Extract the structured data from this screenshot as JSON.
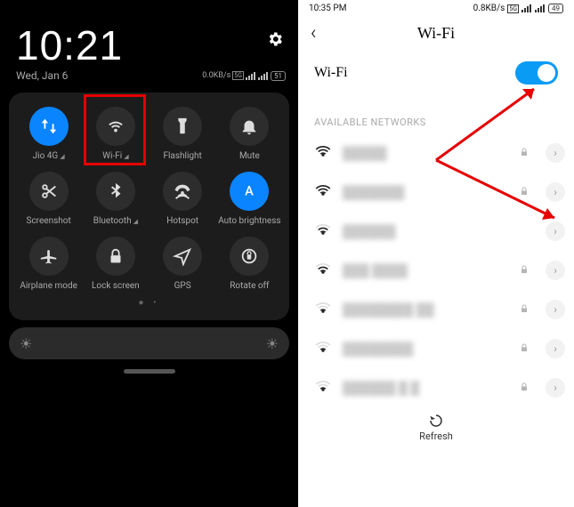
{
  "left": {
    "clock": "10:21",
    "date": "Wed, Jan 6",
    "data_rate": "0.0KB/s",
    "battery": "51",
    "tiles": [
      {
        "label": "Jio 4G",
        "has_sub": true,
        "active": true,
        "icon": "data-swap"
      },
      {
        "label": "Wi-Fi",
        "has_sub": true,
        "active": false,
        "icon": "wifi"
      },
      {
        "label": "Flashlight",
        "has_sub": false,
        "active": false,
        "icon": "flashlight"
      },
      {
        "label": "Mute",
        "has_sub": false,
        "active": false,
        "icon": "bell"
      },
      {
        "label": "Screenshot",
        "has_sub": false,
        "active": false,
        "icon": "scissors"
      },
      {
        "label": "Bluetooth",
        "has_sub": true,
        "active": false,
        "icon": "bluetooth"
      },
      {
        "label": "Hotspot",
        "has_sub": false,
        "active": false,
        "icon": "hotspot"
      },
      {
        "label": "Auto brightness",
        "has_sub": false,
        "active": true,
        "icon": "auto-a"
      },
      {
        "label": "Airplane mode",
        "has_sub": false,
        "active": false,
        "icon": "airplane"
      },
      {
        "label": "Lock screen",
        "has_sub": false,
        "active": false,
        "icon": "lock"
      },
      {
        "label": "GPS",
        "has_sub": false,
        "active": false,
        "icon": "nav"
      },
      {
        "label": "Rotate off",
        "has_sub": false,
        "active": false,
        "icon": "rotate-lock"
      }
    ]
  },
  "right": {
    "status_time": "10:35 PM",
    "data_rate": "0.8KB/s",
    "battery": "49",
    "page_title": "Wi-Fi",
    "toggle_label": "Wi-Fi",
    "toggle_on": true,
    "section_header": "AVAILABLE NETWORKS",
    "networks": [
      {
        "strength": 4,
        "locked": true,
        "detail": true,
        "name": "█████"
      },
      {
        "strength": 4,
        "locked": true,
        "detail": true,
        "name": "███████"
      },
      {
        "strength": 3,
        "locked": false,
        "detail": true,
        "name": "██████"
      },
      {
        "strength": 3,
        "locked": true,
        "detail": true,
        "name": "███ ████"
      },
      {
        "strength": 2,
        "locked": true,
        "detail": true,
        "name": "████████ ██"
      },
      {
        "strength": 2,
        "locked": true,
        "detail": true,
        "name": "████████"
      },
      {
        "strength": 2,
        "locked": true,
        "detail": true,
        "name": "██████ █ █"
      }
    ],
    "refresh_label": "Refresh"
  }
}
